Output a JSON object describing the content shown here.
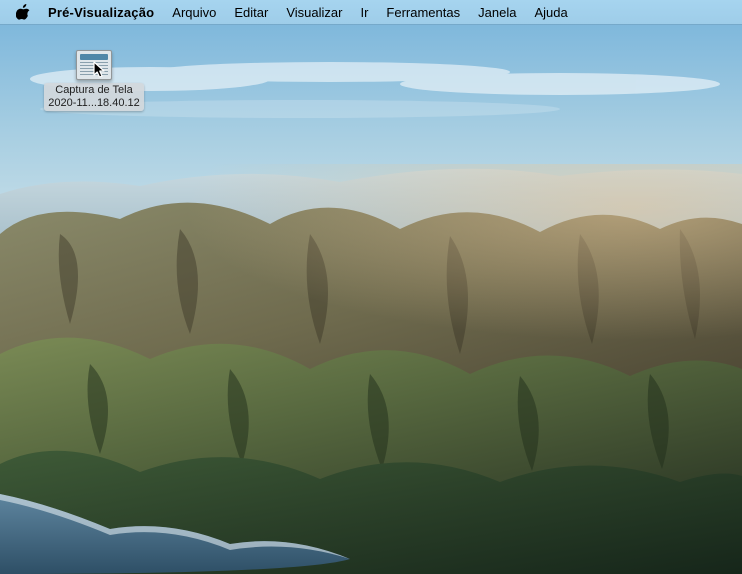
{
  "menubar": {
    "app_name": "Pré-Visualização",
    "items": [
      {
        "label": "Arquivo"
      },
      {
        "label": "Editar"
      },
      {
        "label": "Visualizar"
      },
      {
        "label": "Ir"
      },
      {
        "label": "Ferramentas"
      },
      {
        "label": "Janela"
      },
      {
        "label": "Ajuda"
      }
    ]
  },
  "desktop": {
    "icons": [
      {
        "name_line1": "Captura de Tela",
        "name_line2": "2020-11...18.40.12",
        "icon": "screenshot-thumbnail"
      }
    ]
  }
}
